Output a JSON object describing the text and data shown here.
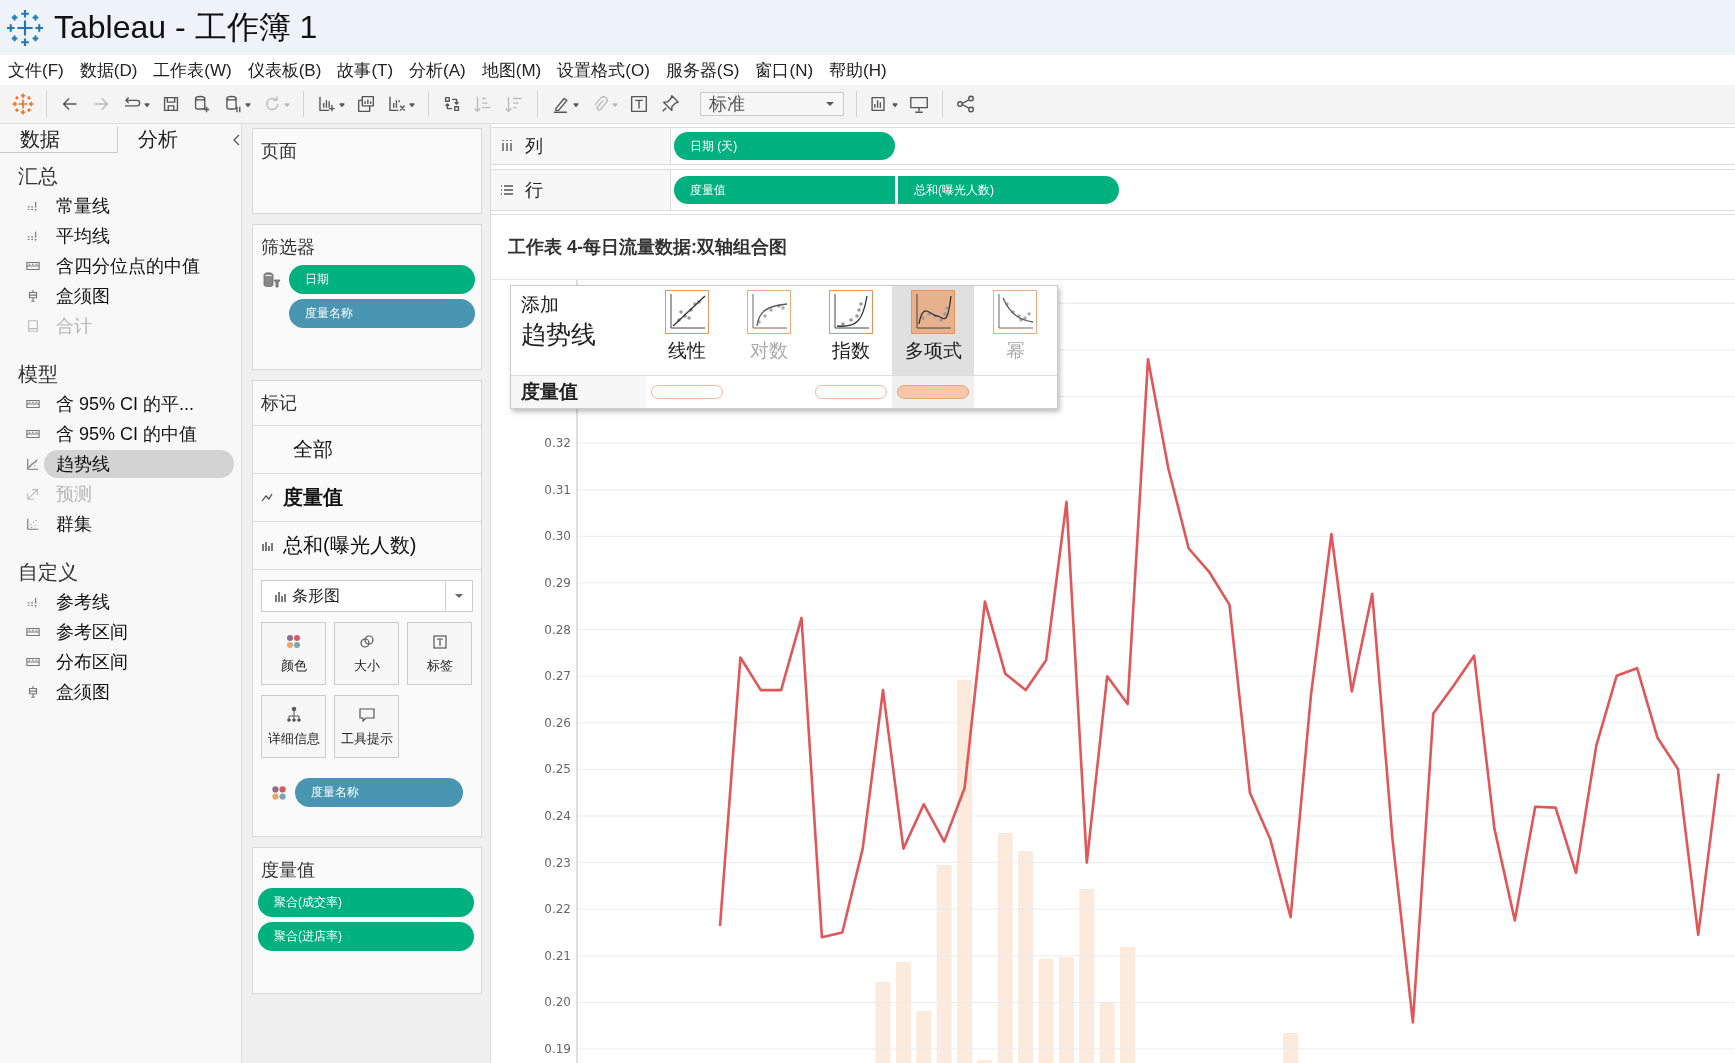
{
  "window": {
    "title": "Tableau - 工作簿 1"
  },
  "menu": [
    "文件(F)",
    "数据(D)",
    "工作表(W)",
    "仪表板(B)",
    "故事(T)",
    "分析(A)",
    "地图(M)",
    "设置格式(O)",
    "服务器(S)",
    "窗口(N)",
    "帮助(H)"
  ],
  "toolbar": [
    {
      "disabled": false
    },
    {
      "disabled": false
    },
    {
      "disabled": true
    },
    {
      "disabled": false
    },
    {
      "disabled": false
    },
    {
      "disabled": false
    },
    {
      "disabled": false
    },
    {
      "disabled": true
    },
    {
      "disabled": false
    },
    {
      "disabled": false
    },
    {
      "disabled": false
    },
    {
      "disabled": false
    },
    {
      "disabled": true
    },
    {
      "disabled": true
    },
    {
      "disabled": false
    },
    {
      "disabled": true
    },
    {
      "disabled": false
    },
    {
      "disabled": false
    },
    {
      "disabled": false
    },
    {
      "disabled": false
    },
    {
      "disabled": false
    }
  ],
  "view_mode": "标准",
  "side_tabs": [
    {
      "label": "数据",
      "selected": false
    },
    {
      "label": "分析",
      "selected": true
    }
  ],
  "analytics": [
    {
      "heading": "汇总",
      "items": [
        {
          "label": "常量线",
          "disabled": false,
          "selected": false
        },
        {
          "label": "平均线",
          "disabled": false,
          "selected": false
        },
        {
          "label": "含四分位点的中值",
          "disabled": false,
          "selected": false
        },
        {
          "label": "盒须图",
          "disabled": false,
          "selected": false
        },
        {
          "label": "合计",
          "disabled": true,
          "selected": false
        }
      ]
    },
    {
      "heading": "模型",
      "items": [
        {
          "label": "含 95% CI 的平...",
          "disabled": false,
          "selected": false
        },
        {
          "label": "含 95% CI 的中值",
          "disabled": false,
          "selected": false
        },
        {
          "label": "趋势线",
          "disabled": false,
          "selected": true
        },
        {
          "label": "预测",
          "disabled": true,
          "selected": false
        },
        {
          "label": "群集",
          "disabled": false,
          "selected": false
        }
      ]
    },
    {
      "heading": "自定义",
      "items": [
        {
          "label": "参考线",
          "disabled": false,
          "selected": false
        },
        {
          "label": "参考区间",
          "disabled": false,
          "selected": false
        },
        {
          "label": "分布区间",
          "disabled": false,
          "selected": false
        },
        {
          "label": "盒须图",
          "disabled": false,
          "selected": false
        }
      ]
    }
  ],
  "pages_card": {
    "title": "页面"
  },
  "filters_card": {
    "title": "筛选器",
    "pills": [
      {
        "label": "日期",
        "color": "#00b180"
      },
      {
        "label": "度量名称",
        "color": "#4996b2"
      }
    ]
  },
  "marks_card": {
    "title": "标记",
    "tabs": [
      {
        "label": "全部",
        "kind": "all",
        "selected": false
      },
      {
        "label": "度量值",
        "kind": "line",
        "selected": true
      },
      {
        "label": "总和(曝光人数)",
        "kind": "bar",
        "selected": false
      }
    ],
    "mark_type": "条形图",
    "buttons": [
      "颜色",
      "大小",
      "标签",
      "详细信息",
      "工具提示"
    ],
    "color_pill": {
      "label": "度量名称",
      "color": "#4996b2"
    }
  },
  "measure_values_card": {
    "title": "度量值",
    "pills": [
      "聚合(成交率)",
      "聚合(进店率)"
    ]
  },
  "columns_shelf": {
    "label": "列",
    "pills": [
      "日期 (天)"
    ]
  },
  "rows_shelf": {
    "label": "行",
    "pills": [
      "度量值",
      "总和(曝光人数)"
    ]
  },
  "sheet": {
    "title": "工作表 4-每日流量数据:双轴组合图",
    "chart_data": {
      "type": "line",
      "grid": true,
      "ylim": [
        0.187,
        0.355
      ],
      "yticks": [
        {
          "value": 0.19,
          "label": "0.19"
        },
        {
          "value": 0.2,
          "label": "0.20"
        },
        {
          "value": 0.21,
          "label": "0.21"
        },
        {
          "value": 0.22,
          "label": "0.22"
        },
        {
          "value": 0.23,
          "label": "0.23"
        },
        {
          "value": 0.24,
          "label": "0.24"
        },
        {
          "value": 0.25,
          "label": "0.25"
        },
        {
          "value": 0.26,
          "label": "0.26"
        },
        {
          "value": 0.27,
          "label": "0.27"
        },
        {
          "value": 0.28,
          "label": "0.28"
        },
        {
          "value": 0.29,
          "label": "0.29"
        },
        {
          "value": 0.3,
          "label": "0.30"
        },
        {
          "value": 0.31,
          "label": "0.31"
        },
        {
          "value": 0.32,
          "label": "0.32"
        }
      ],
      "series": [
        {
          "color": "#e15759",
          "values": [
            0.2164,
            0.274,
            0.267,
            0.267,
            0.2825,
            0.214,
            0.215,
            0.233,
            0.267,
            0.233,
            0.2425,
            0.2345,
            0.246,
            0.286,
            0.2705,
            0.267,
            0.2734,
            0.3074,
            0.23,
            0.27,
            0.264,
            0.338,
            0.3145,
            0.2974,
            0.2924,
            0.2853,
            0.245,
            0.235,
            0.2183,
            0.266,
            0.3005,
            0.2667,
            0.2877,
            0.235,
            0.1957,
            0.262,
            0.268,
            0.2744,
            0.2373,
            0.2176,
            0.242,
            0.2418,
            0.2278,
            0.2551,
            0.2701,
            0.2717,
            0.2568,
            0.2501,
            0.2145,
            0.2491,
            null
          ]
        }
      ]
    }
  },
  "trend_popup": {
    "title_small": "添加",
    "title_large": "趋势线",
    "row_label": "度量值",
    "options": [
      {
        "label": "线性",
        "disabled": false,
        "selected": false,
        "drop_target": true
      },
      {
        "label": "对数",
        "disabled": true,
        "selected": false,
        "drop_target": false
      },
      {
        "label": "指数",
        "disabled": false,
        "selected": false,
        "drop_target": true
      },
      {
        "label": "多项式",
        "disabled": false,
        "selected": true,
        "drop_target": true
      },
      {
        "label": "幂",
        "disabled": true,
        "selected": false,
        "drop_target": false
      }
    ]
  }
}
